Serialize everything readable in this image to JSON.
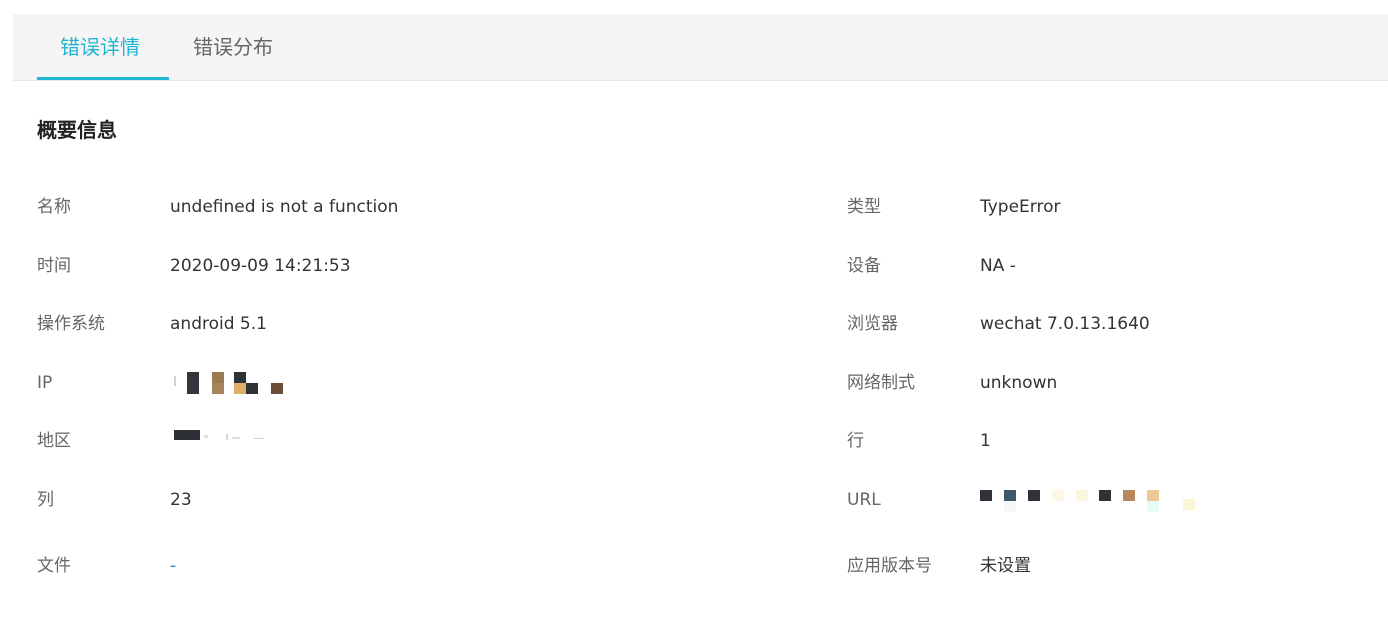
{
  "tabs": [
    {
      "label": "错误详情",
      "active": true
    },
    {
      "label": "错误分布",
      "active": false
    }
  ],
  "section": {
    "title": "概要信息"
  },
  "left_rows": [
    {
      "label": "名称",
      "value": "undefined is not a function"
    },
    {
      "label": "时间",
      "value": "2020-09-09 14:21:53"
    },
    {
      "label": "操作系统",
      "value": "android 5.1"
    },
    {
      "label": "IP",
      "value": ""
    },
    {
      "label": "地区",
      "value": ""
    },
    {
      "label": "列",
      "value": "23"
    },
    {
      "label": "文件",
      "value": "-"
    }
  ],
  "right_rows": [
    {
      "label": "类型",
      "value": "TypeError"
    },
    {
      "label": "设备",
      "value": "NA -"
    },
    {
      "label": "浏览器",
      "value": "wechat 7.0.13.1640"
    },
    {
      "label": "网络制式",
      "value": "unknown"
    },
    {
      "label": "行",
      "value": "1"
    },
    {
      "label": "URL",
      "value": ""
    },
    {
      "label": "应用版本号",
      "value": "未设置"
    }
  ],
  "colors": {
    "accent": "#1fb6d3",
    "link": "#1b7bd6"
  }
}
